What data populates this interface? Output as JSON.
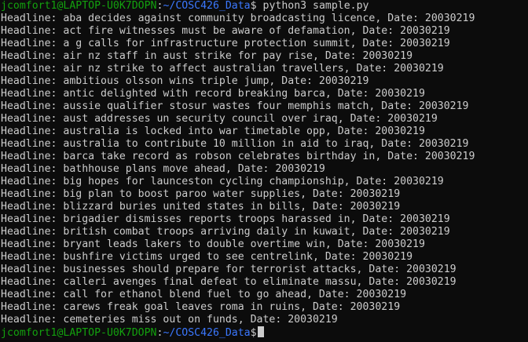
{
  "colors": {
    "background": "#0c0c0c",
    "text": "#cccccc",
    "prompt_user": "#13a10e",
    "prompt_path": "#3b78ff"
  },
  "prompt": {
    "user_host": "jcomfort1@LAPTOP-U0K7DOPN",
    "separator": ":",
    "path": "~/COSC426_Data",
    "dollar": "$"
  },
  "command": " python3 sample.py",
  "output_lines": [
    "Headline: aba decides against community broadcasting licence, Date: 20030219",
    "Headline: act fire witnesses must be aware of defamation, Date: 20030219",
    "Headline: a g calls for infrastructure protection summit, Date: 20030219",
    "Headline: air nz staff in aust strike for pay rise, Date: 20030219",
    "Headline: air nz strike to affect australian travellers, Date: 20030219",
    "Headline: ambitious olsson wins triple jump, Date: 20030219",
    "Headline: antic delighted with record breaking barca, Date: 20030219",
    "Headline: aussie qualifier stosur wastes four memphis match, Date: 20030219",
    "Headline: aust addresses un security council over iraq, Date: 20030219",
    "Headline: australia is locked into war timetable opp, Date: 20030219",
    "Headline: australia to contribute 10 million in aid to iraq, Date: 20030219",
    "Headline: barca take record as robson celebrates birthday in, Date: 20030219",
    "Headline: bathhouse plans move ahead, Date: 20030219",
    "Headline: big hopes for launceston cycling championship, Date: 20030219",
    "Headline: big plan to boost paroo water supplies, Date: 20030219",
    "Headline: blizzard buries united states in bills, Date: 20030219",
    "Headline: brigadier dismisses reports troops harassed in, Date: 20030219",
    "Headline: british combat troops arriving daily in kuwait, Date: 20030219",
    "Headline: bryant leads lakers to double overtime win, Date: 20030219",
    "Headline: bushfire victims urged to see centrelink, Date: 20030219",
    "Headline: businesses should prepare for terrorist attacks, Date: 20030219",
    "Headline: calleri avenges final defeat to eliminate massu, Date: 20030219",
    "Headline: call for ethanol blend fuel to go ahead, Date: 20030219",
    "Headline: carews freak goal leaves roma in ruins, Date: 20030219",
    "Headline: cemeteries miss out on funds, Date: 20030219"
  ]
}
